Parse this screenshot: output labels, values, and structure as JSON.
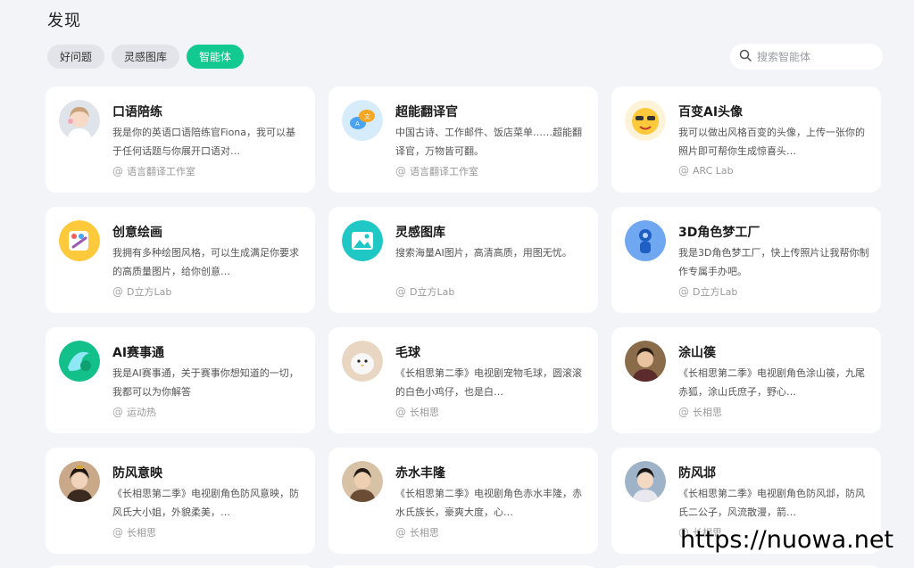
{
  "page": {
    "title": "发现"
  },
  "tabs": [
    {
      "label": "好问题",
      "active": false
    },
    {
      "label": "灵感图库",
      "active": false
    },
    {
      "label": "智能体",
      "active": true
    }
  ],
  "search": {
    "placeholder": "搜索智能体",
    "icon": "search-icon"
  },
  "accent_color": "#12c98f",
  "cards": [
    {
      "title": "口语陪练",
      "desc": "我是你的英语口语陪练官Fiona，我可以基于任何话题与你展开口语对…",
      "author": "语言翻译工作室",
      "icon": "girl-avatar-icon"
    },
    {
      "title": "超能翻译官",
      "desc": "中国古诗、工作邮件、饭店菜单……超能翻译官，万物皆可翻。",
      "author": "语言翻译工作室",
      "icon": "translate-bubble-icon"
    },
    {
      "title": "百变AI头像",
      "desc": "我可以做出风格百变的头像，上传一张你的照片即可帮你生成惊喜头…",
      "author": "ARC Lab",
      "icon": "cool-emoji-icon"
    },
    {
      "title": "创意绘画",
      "desc": "我拥有多种绘图风格，可以生成满足你要求的高质量图片，给你创意…",
      "author": "D立方Lab",
      "icon": "paint-palette-icon"
    },
    {
      "title": "灵感图库",
      "desc": "搜索海量AI图片，高清高质，用图无忧。",
      "author": "D立方Lab",
      "icon": "image-gallery-icon"
    },
    {
      "title": "3D角色梦工厂",
      "desc": "我是3D角色梦工厂，快上传照片让我帮你制作专属手办吧。",
      "author": "D立方Lab",
      "icon": "3d-figure-icon"
    },
    {
      "title": "AI赛事通",
      "desc": "我是AI赛事通，关于赛事你想知道的一切，我都可以为你解答",
      "author": "运动热",
      "icon": "sports-logo-icon"
    },
    {
      "title": "毛球",
      "desc": "《长相思第二季》电视剧宠物毛球，圆滚滚的白色小鸡仔，也是白…",
      "author": "长相思",
      "icon": "white-bird-avatar-icon"
    },
    {
      "title": "涂山篌",
      "desc": "《长相思第二季》电视剧角色涂山篌，九尾赤狐，涂山氏庶子，野心…",
      "author": "长相思",
      "icon": "male-portrait-icon"
    },
    {
      "title": "防风意映",
      "desc": "《长相思第二季》电视剧角色防风意映，防风氏大小姐，外貌柔美，…",
      "author": "长相思",
      "icon": "female-portrait-icon"
    },
    {
      "title": "赤水丰隆",
      "desc": "《长相思第二季》电视剧角色赤水丰隆，赤水氏族长，豪爽大度，心…",
      "author": "长相思",
      "icon": "male-portrait-icon"
    },
    {
      "title": "防风邶",
      "desc": "《长相思第二季》电视剧角色防风邶，防风氏二公子，风流散漫，箭…",
      "author": "长相思",
      "icon": "male-portrait-icon"
    }
  ],
  "watermark": "https://nuowa.net"
}
